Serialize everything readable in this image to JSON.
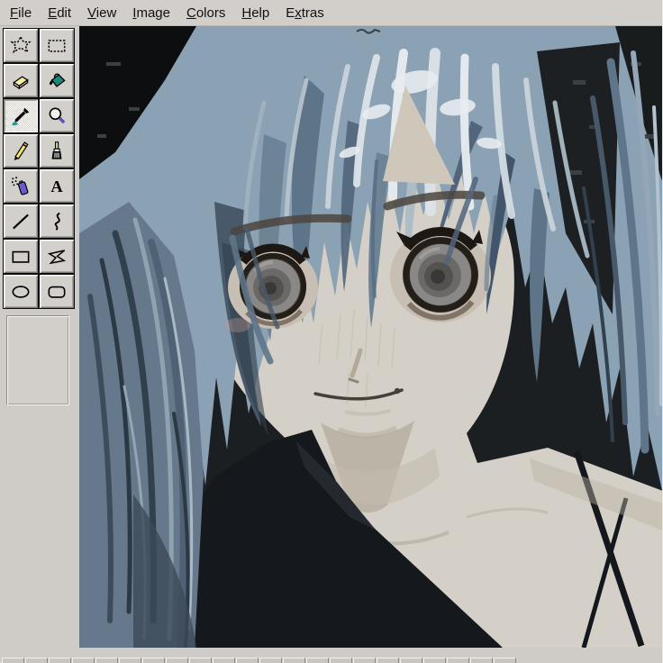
{
  "menubar": {
    "items": [
      {
        "label": "File",
        "mnemonic_index": 0
      },
      {
        "label": "Edit",
        "mnemonic_index": 0
      },
      {
        "label": "View",
        "mnemonic_index": 0
      },
      {
        "label": "Image",
        "mnemonic_index": 0
      },
      {
        "label": "Colors",
        "mnemonic_index": 0
      },
      {
        "label": "Help",
        "mnemonic_index": 0
      },
      {
        "label": "Extras",
        "mnemonic_index": 1
      }
    ]
  },
  "toolbox": {
    "tools": [
      {
        "name": "free-form-select",
        "icon": "free-form-select-icon",
        "selected": false
      },
      {
        "name": "select",
        "icon": "select-icon",
        "selected": false
      },
      {
        "name": "eraser",
        "icon": "eraser-icon",
        "selected": false
      },
      {
        "name": "fill-with-color",
        "icon": "fill-bucket-icon",
        "selected": false
      },
      {
        "name": "pick-color",
        "icon": "eyedropper-icon",
        "selected": true
      },
      {
        "name": "magnifier",
        "icon": "magnifier-icon",
        "selected": false
      },
      {
        "name": "pencil",
        "icon": "pencil-icon",
        "selected": false
      },
      {
        "name": "brush",
        "icon": "brush-icon",
        "selected": false
      },
      {
        "name": "airbrush",
        "icon": "airbrush-icon",
        "selected": false
      },
      {
        "name": "text",
        "icon": "text-icon",
        "selected": false
      },
      {
        "name": "line",
        "icon": "line-icon",
        "selected": false
      },
      {
        "name": "curve",
        "icon": "curve-icon",
        "selected": false
      },
      {
        "name": "rectangle",
        "icon": "rectangle-icon",
        "selected": false
      },
      {
        "name": "polygon",
        "icon": "polygon-icon",
        "selected": false
      },
      {
        "name": "ellipse",
        "icon": "ellipse-icon",
        "selected": false
      },
      {
        "name": "rounded-rectangle",
        "icon": "rounded-rectangle-icon",
        "selected": false
      }
    ],
    "text_tool_glyph": "A"
  },
  "canvas": {
    "alt": "Painted anime-style portrait of a girl with long light blue-gray hair in twin tails, large gray eyes, dark top, on a dark background"
  },
  "palette": {
    "visible_cell_count": 22,
    "cell_color": "#c9c6c2"
  },
  "colors": {
    "chrome": "#d2cfcb",
    "chrome_highlight": "#ffffff",
    "chrome_shadow": "#7f7c78",
    "selected_tool_bg": "#e6e4e1",
    "canvas_background": "#1c1f21",
    "hair_base": "#8ba1b4",
    "hair_light": "#dde4e9",
    "hair_dark": "#3e4e5e",
    "skin": "#d6d1c8",
    "shirt": "#15181c",
    "magnifier_handle": "#5b4fc0",
    "fill_teal": "#1f8f8f"
  }
}
